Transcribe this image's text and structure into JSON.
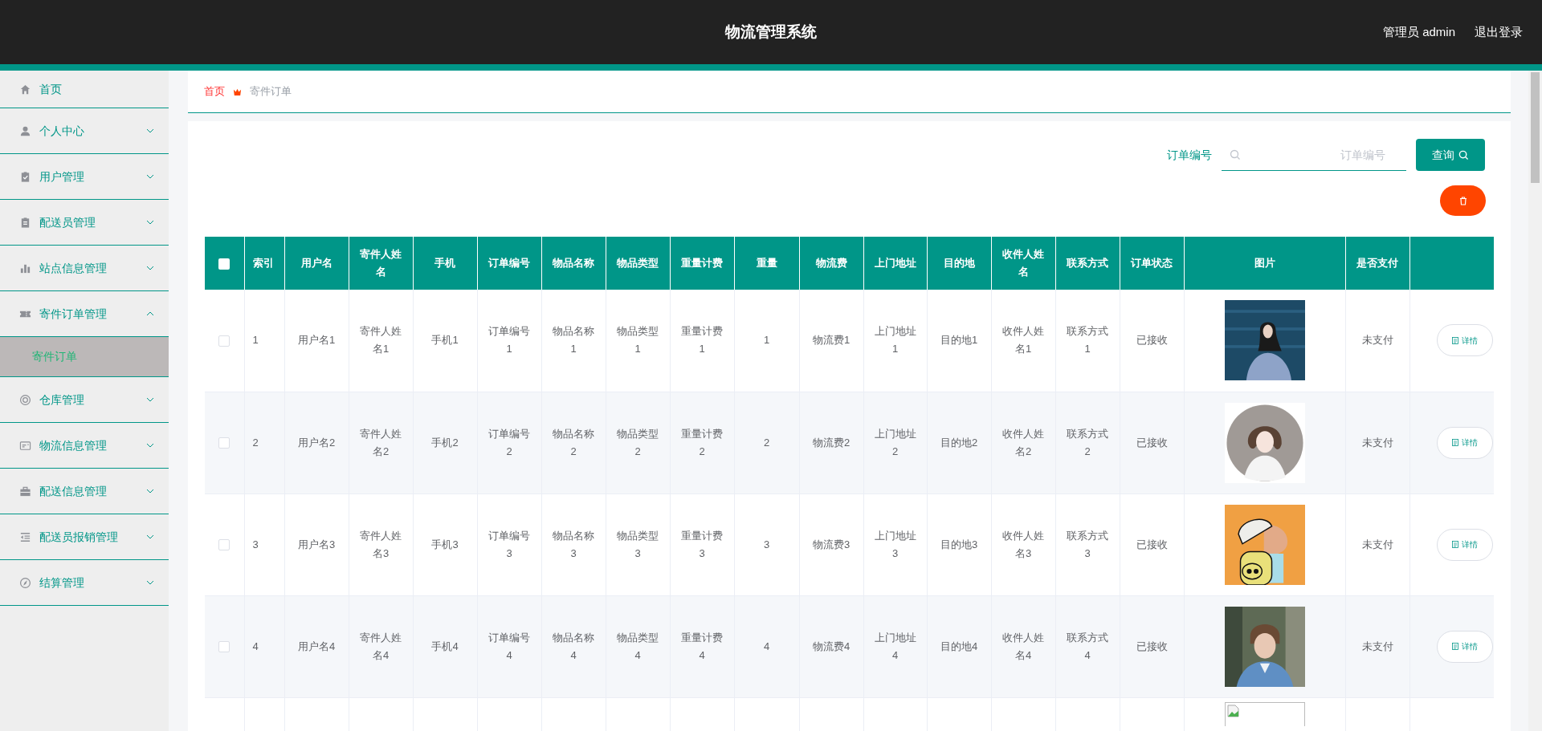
{
  "header": {
    "title": "物流管理系统",
    "user": "管理员 admin",
    "logout": "退出登录"
  },
  "sidebar": {
    "items": [
      {
        "kind": "link",
        "label": "首页"
      },
      {
        "kind": "menu",
        "label": "个人中心",
        "expanded": false
      },
      {
        "kind": "menu",
        "label": "用户管理",
        "expanded": false
      },
      {
        "kind": "menu",
        "label": "配送员管理",
        "expanded": false
      },
      {
        "kind": "menu",
        "label": "站点信息管理",
        "expanded": false
      },
      {
        "kind": "menu",
        "label": "寄件订单管理",
        "expanded": true,
        "children": [
          {
            "label": "寄件订单",
            "selected": true
          }
        ]
      },
      {
        "kind": "menu",
        "label": "仓库管理",
        "expanded": false
      },
      {
        "kind": "menu",
        "label": "物流信息管理",
        "expanded": false
      },
      {
        "kind": "menu",
        "label": "配送信息管理",
        "expanded": false
      },
      {
        "kind": "menu",
        "label": "配送员报销管理",
        "expanded": false
      },
      {
        "kind": "menu",
        "label": "结算管理",
        "expanded": false
      }
    ]
  },
  "breadcrumb": [
    "首页",
    "寄件订单"
  ],
  "search": {
    "label": "订单编号",
    "placeholder": "订单编号",
    "button": "查询"
  },
  "table": {
    "select_all": {
      "checked": false
    },
    "columns": [
      "索引",
      "用户名",
      "寄件人姓名",
      "手机",
      "订单编号",
      "物品名称",
      "物品类型",
      "重量计费",
      "重量",
      "物流费",
      "上门地址",
      "目的地",
      "收件人姓名",
      "联系方式",
      "订单状态",
      "图片",
      "是否支付"
    ],
    "rows": [
      {
        "checked": false,
        "cells": [
          "1",
          "用户名1",
          "寄件人姓名1",
          "手机1",
          "订单编号1",
          "物品名称1",
          "物品类型1",
          "重量计费1",
          "1",
          "物流费1",
          "上门地址1",
          "目的地1",
          "收件人姓名1",
          "联系方式1",
          "已接收"
        ],
        "kind": "picture",
        "paid": "未支付",
        "action": "详情"
      },
      {
        "checked": false,
        "cells": [
          "2",
          "用户名2",
          "寄件人姓名2",
          "手机2",
          "订单编号2",
          "物品名称2",
          "物品类型2",
          "重量计费2",
          "2",
          "物流费2",
          "上门地址2",
          "目的地2",
          "收件人姓名2",
          "联系方式2",
          "已接收"
        ],
        "kind": "picture",
        "paid": "未支付",
        "action": "详情"
      },
      {
        "checked": false,
        "cells": [
          "3",
          "用户名3",
          "寄件人姓名3",
          "手机3",
          "订单编号3",
          "物品名称3",
          "物品类型3",
          "重量计费3",
          "3",
          "物流费3",
          "上门地址3",
          "目的地3",
          "收件人姓名3",
          "联系方式3",
          "已接收"
        ],
        "kind": "picture",
        "paid": "未支付",
        "action": "详情"
      },
      {
        "checked": false,
        "cells": [
          "4",
          "用户名4",
          "寄件人姓名4",
          "手机4",
          "订单编号4",
          "物品名称4",
          "物品类型4",
          "重量计费4",
          "4",
          "物流费4",
          "上门地址4",
          "目的地4",
          "收件人姓名4",
          "联系方式4",
          "已接收"
        ],
        "kind": "picture",
        "paid": "未支付",
        "action": "详情"
      },
      {
        "kind": "broken"
      }
    ]
  }
}
